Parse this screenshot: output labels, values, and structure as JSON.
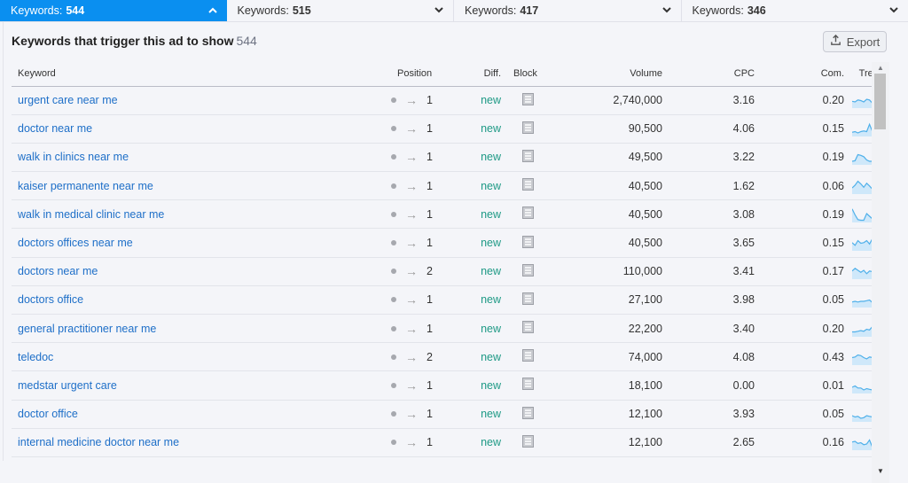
{
  "tabs": [
    {
      "label": "Keywords:",
      "count": "544",
      "active": true,
      "chevron": "up"
    },
    {
      "label": "Keywords:",
      "count": "515",
      "active": false,
      "chevron": "down"
    },
    {
      "label": "Keywords:",
      "count": "417",
      "active": false,
      "chevron": "down"
    },
    {
      "label": "Keywords:",
      "count": "346",
      "active": false,
      "chevron": "down"
    }
  ],
  "panel": {
    "title": "Keywords that trigger this ad to show",
    "total": "544",
    "export_label": "Export"
  },
  "columns": {
    "keyword": "Keyword",
    "position": "Position",
    "diff": "Diff.",
    "block": "Block",
    "volume": "Volume",
    "cpc": "CPC",
    "com": "Com.",
    "trend": "Trend"
  },
  "colors": {
    "accent": "#0a8ff0",
    "link": "#1e6fc8",
    "diff_new": "#1f9a86",
    "trend_line": "#4fb0ea",
    "trend_fill": "#cfe8fa"
  },
  "rows": [
    {
      "keyword": "urgent care near me",
      "position": "1",
      "diff": "new",
      "volume": "2,740,000",
      "cpc": "3.16",
      "com": "0.20",
      "trend": [
        0.45,
        0.4,
        0.55,
        0.5,
        0.4,
        0.6,
        0.55,
        0.3,
        0.35,
        0.9,
        0.6,
        0.55
      ]
    },
    {
      "keyword": "doctor near me",
      "position": "1",
      "diff": "new",
      "volume": "90,500",
      "cpc": "4.06",
      "com": "0.15",
      "trend": [
        0.25,
        0.3,
        0.2,
        0.3,
        0.35,
        0.3,
        0.85,
        0.3,
        0.35,
        0.3,
        0.25,
        0.75
      ]
    },
    {
      "keyword": "walk in clinics near me",
      "position": "1",
      "diff": "new",
      "volume": "49,500",
      "cpc": "3.22",
      "com": "0.19",
      "trend": [
        0.2,
        0.25,
        0.7,
        0.65,
        0.55,
        0.3,
        0.2,
        0.2,
        0.15,
        0.2,
        0.95,
        0.2
      ]
    },
    {
      "keyword": "kaiser permanente near me",
      "position": "1",
      "diff": "new",
      "volume": "40,500",
      "cpc": "1.62",
      "com": "0.06",
      "trend": [
        0.4,
        0.6,
        0.9,
        0.7,
        0.45,
        0.75,
        0.55,
        0.3,
        0.45,
        0.25,
        0.4,
        0.35
      ]
    },
    {
      "keyword": "walk in medical clinic near me",
      "position": "1",
      "diff": "new",
      "volume": "40,500",
      "cpc": "3.08",
      "com": "0.19",
      "trend": [
        0.95,
        0.5,
        0.15,
        0.1,
        0.1,
        0.6,
        0.4,
        0.2,
        0.1,
        0.05,
        0.1,
        0.2
      ]
    },
    {
      "keyword": "doctors offices near me",
      "position": "1",
      "diff": "new",
      "volume": "40,500",
      "cpc": "3.65",
      "com": "0.15",
      "trend": [
        0.55,
        0.35,
        0.7,
        0.5,
        0.55,
        0.7,
        0.45,
        0.85,
        0.4,
        0.75,
        0.3,
        0.6
      ]
    },
    {
      "keyword": "doctors near me",
      "position": "2",
      "diff": "new",
      "volume": "110,000",
      "cpc": "3.41",
      "com": "0.17",
      "trend": [
        0.55,
        0.75,
        0.6,
        0.45,
        0.6,
        0.35,
        0.55,
        0.5,
        0.35,
        0.55,
        0.3,
        0.35
      ]
    },
    {
      "keyword": "doctors office",
      "position": "1",
      "diff": "new",
      "volume": "27,100",
      "cpc": "3.98",
      "com": "0.05",
      "trend": [
        0.35,
        0.4,
        0.35,
        0.4,
        0.4,
        0.45,
        0.5,
        0.3,
        0.35,
        0.2,
        0.2,
        0.35
      ]
    },
    {
      "keyword": "general practitioner near me",
      "position": "1",
      "diff": "new",
      "volume": "22,200",
      "cpc": "3.40",
      "com": "0.20",
      "trend": [
        0.3,
        0.3,
        0.35,
        0.4,
        0.35,
        0.5,
        0.45,
        0.7,
        0.35,
        0.35,
        0.35,
        0.35
      ]
    },
    {
      "keyword": "teledoc",
      "position": "2",
      "diff": "new",
      "volume": "74,000",
      "cpc": "4.08",
      "com": "0.43",
      "trend": [
        0.5,
        0.55,
        0.7,
        0.65,
        0.5,
        0.4,
        0.55,
        0.5,
        0.45,
        0.3,
        0.4,
        0.55
      ]
    },
    {
      "keyword": "medstar urgent care",
      "position": "1",
      "diff": "new",
      "volume": "18,100",
      "cpc": "0.00",
      "com": "0.01",
      "trend": [
        0.4,
        0.5,
        0.35,
        0.35,
        0.2,
        0.3,
        0.25,
        0.2,
        0.15,
        0.1,
        0.3,
        0.75
      ]
    },
    {
      "keyword": "doctor office",
      "position": "1",
      "diff": "new",
      "volume": "12,100",
      "cpc": "3.93",
      "com": "0.05",
      "trend": [
        0.4,
        0.3,
        0.35,
        0.2,
        0.25,
        0.4,
        0.35,
        0.3,
        0.3,
        0.4,
        0.8,
        0.35
      ]
    },
    {
      "keyword": "internal medicine doctor near me",
      "position": "1",
      "diff": "new",
      "volume": "12,100",
      "cpc": "2.65",
      "com": "0.16",
      "trend": [
        0.55,
        0.6,
        0.45,
        0.5,
        0.35,
        0.4,
        0.7,
        0.15,
        0.55,
        0.2,
        0.35,
        0.3
      ]
    }
  ]
}
